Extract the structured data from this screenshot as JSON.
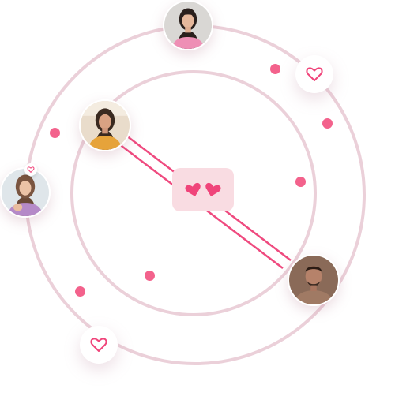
{
  "colors": {
    "ring": "#ebd0d9",
    "dot": "#f3628c",
    "heart": "#f0447a",
    "card_bg": "#f9dce2",
    "line": "#ef4a7f"
  },
  "icons": {
    "heart_outline": "heart-outline-icon",
    "heart_filled": "heart-filled-icon"
  },
  "profiles": [
    {
      "name": "woman-pink-sweater",
      "role": "top-avatar"
    },
    {
      "name": "woman-yellow-top",
      "role": "left-inner-avatar"
    },
    {
      "name": "woman-lilac-sweater",
      "role": "left-outer-avatar"
    },
    {
      "name": "man-beard",
      "role": "bottom-right-avatar"
    }
  ],
  "match": {
    "icon": "two-hearts-icon"
  }
}
